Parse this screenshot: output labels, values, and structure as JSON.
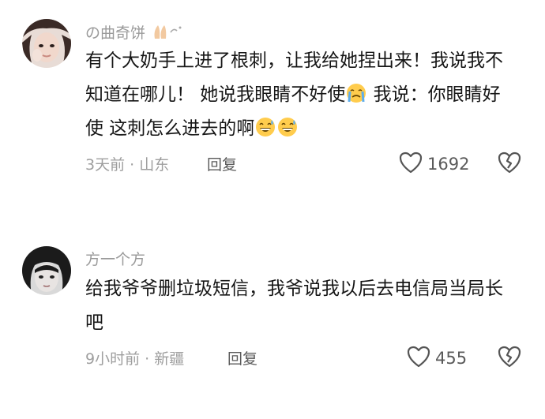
{
  "comments": [
    {
      "username": "の曲奇饼",
      "text_segments": [
        "有个大奶手上进了根刺，让我给她捏出来！我说我不知道在哪儿！ 她说我眼睛不好使",
        " 我说：你眼睛好使 这刺怎么进去的啊"
      ],
      "location_time": "3天前 · 山东",
      "reply_label": "回复",
      "like_count": "1692",
      "icons": [
        "praying-hands-icon",
        "crying-face-icon",
        "grinning-sweat-face-icon",
        "grinning-sweat-face-icon"
      ]
    },
    {
      "username": "方一个方",
      "text_segments": [
        "给我爷爷删垃圾短信，我爷说我以后去电信局当局长吧"
      ],
      "location_time": "9小时前 · 新疆",
      "reply_label": "回复",
      "like_count": "455"
    }
  ],
  "colors": {
    "meta_gray": "#9e9e9e",
    "text": "#161616",
    "icon_stroke": "#555555"
  }
}
